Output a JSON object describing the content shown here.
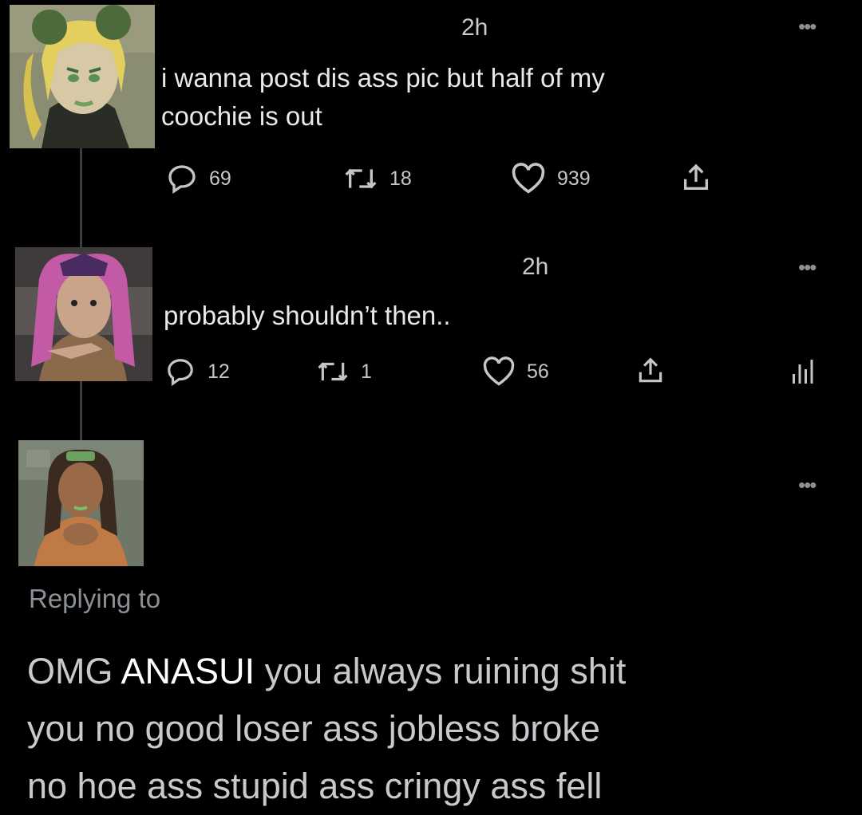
{
  "tweets": [
    {
      "time": "2h",
      "text_line1": "i wanna post dis ass pic but half of my",
      "text_line2": "coochie is out",
      "replies": "69",
      "retweets": "18",
      "likes": "939"
    },
    {
      "time": "2h",
      "text": "probably shouldn’t then..",
      "replies": "12",
      "retweets": "1",
      "likes": "56"
    }
  ],
  "reply": {
    "replying_to": "Replying to",
    "line1_start": "OMG",
    "name": "ANASUI",
    "line1_end": "you always ruining shit",
    "line2": "you no good loser ass jobless broke",
    "line3": "no hoe ass stupid ass cringy ass fell"
  },
  "icons": {
    "reply": "speech-bubble-icon",
    "retweet": "retweet-icon",
    "like": "heart-icon",
    "share": "share-icon",
    "analytics": "analytics-icon",
    "more": "more-dots-icon"
  },
  "colors": {
    "background": "#000000",
    "text": "#e7e9ea",
    "muted": "#8b9096",
    "highlight": "#ffffff"
  }
}
